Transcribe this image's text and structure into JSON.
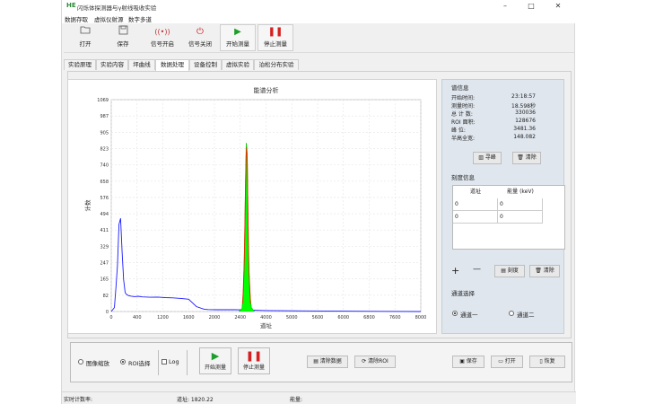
{
  "window": {
    "title": "闪烁体探测器与γ射线吸收实验",
    "minimize": "–",
    "maximize": "□",
    "close": "✕"
  },
  "menu": [
    "数据存取",
    "虚拟仪射源",
    "数字多道"
  ],
  "toolbar": {
    "open": "打开",
    "save": "保存",
    "signal_on": "信号开启",
    "signal_off": "信号关闭",
    "start": "开始测量",
    "stop": "停止测量"
  },
  "tabs": [
    "实验原理",
    "实验内容",
    "坪曲线",
    "数据处理",
    "设备控制",
    "虚拟实验",
    "泊松分布实验"
  ],
  "active_tab": 3,
  "chart_data": {
    "type": "area",
    "title": "能谱分析",
    "xlabel": "道址",
    "ylabel": "计数",
    "xlim": [
      0,
      8000
    ],
    "ylim": [
      0,
      1069
    ],
    "x_ticks": [
      "0",
      "400",
      "1200",
      "1600",
      "2000",
      "2400",
      "4000",
      "5000",
      "5600",
      "6000",
      "6800",
      "7600",
      "8000"
    ],
    "y_ticks": [
      "1069",
      "987",
      "905",
      "823",
      "740",
      "658",
      "576",
      "494",
      "411",
      "329",
      "247",
      "165",
      "82",
      "0"
    ],
    "grid": true,
    "series": [
      {
        "color": "#1a1aff",
        "x": [
          0,
          80,
          120,
          160,
          200,
          240,
          280,
          320,
          360,
          400,
          450,
          500,
          600,
          700,
          800,
          1000,
          1200,
          1400,
          1600,
          1800,
          2000,
          2200,
          2400,
          2500,
          2700,
          3000,
          3200,
          3400,
          3600,
          3800,
          4000,
          4400,
          5000,
          6000,
          7000,
          8000
        ],
        "y": [
          0,
          20,
          120,
          230,
          440,
          470,
          300,
          160,
          95,
          85,
          80,
          78,
          75,
          77,
          74,
          72,
          73,
          70,
          69,
          66,
          62,
          25,
          12,
          10,
          9,
          9,
          9,
          8,
          7,
          6,
          5,
          4,
          3,
          2,
          1,
          0
        ]
      },
      {
        "color": "#00d200",
        "fill": "#00ff00",
        "x": [
          3300,
          3380,
          3420,
          3450,
          3470,
          3490,
          3510,
          3530,
          3550,
          3580,
          3620,
          3700
        ],
        "y": [
          0,
          15,
          120,
          380,
          640,
          850,
          800,
          540,
          260,
          90,
          20,
          0
        ]
      },
      {
        "color": "#e03000",
        "x": [
          3400,
          3440,
          3465,
          3485,
          3500,
          3515,
          3535,
          3560,
          3600
        ],
        "y": [
          40,
          260,
          560,
          780,
          830,
          760,
          480,
          200,
          40
        ]
      }
    ]
  },
  "info": {
    "title": "谱信息",
    "rows": [
      {
        "k": "开始时间:",
        "v": "23:18:57"
      },
      {
        "k": "测量时间:",
        "v": "18.598秒"
      },
      {
        "k": "总 计 数:",
        "v": "330036"
      },
      {
        "k": "ROI 面积:",
        "v": "128676"
      },
      {
        "k": "峰      位:",
        "v": "3481.36"
      },
      {
        "k": "半高全宽:",
        "v": "148.082"
      }
    ],
    "find_peak": "寻峰",
    "clear": "清除"
  },
  "roi": {
    "title": "刻度信息",
    "col1": "道址",
    "col2": "能量 (keV)",
    "rows": [
      [
        "0",
        "0"
      ],
      [
        "0",
        "0"
      ]
    ],
    "add": "+",
    "remove": "—",
    "calibrate": "刻度",
    "clear": "清除"
  },
  "channel": {
    "title": "通道选择",
    "ch1": "通道一",
    "ch2": "通道二"
  },
  "bottom": {
    "image_zoom": "图像缩放",
    "roi_select": "ROI选择",
    "log": "Log",
    "start": "开始测量",
    "stop": "停止测量",
    "clear_data": "清除数据",
    "clear_roi": "清除ROI",
    "save": "保存",
    "open": "打开",
    "restore": "恢复"
  },
  "status": {
    "count": "实时计数率:",
    "channel": "道址:  1820.22",
    "energy": "能量:"
  },
  "colors": {
    "accent_green": "#00ff00",
    "spectrum_blue": "#1a1aff",
    "panel": "#dfe6ee"
  }
}
